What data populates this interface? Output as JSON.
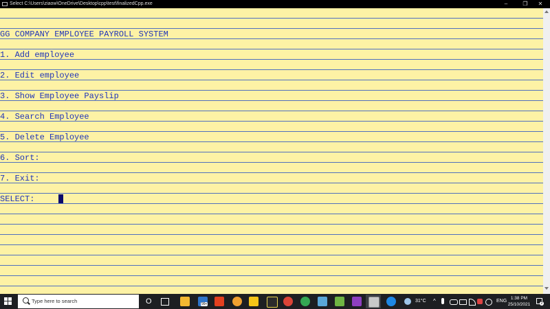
{
  "window": {
    "title": "Select C:\\Users\\ziaow\\OneDrive\\Desktop\\cpp\\test\\finalizedCpp.exe",
    "minimize_glyph": "–",
    "maximize_glyph": "❐",
    "close_glyph": "✕"
  },
  "console": {
    "heading": "GG COMPANY EMPLOYEE PAYROLL SYSTEM",
    "menu": [
      "1. Add employee",
      "2. Edit employee",
      "3. Show Employee Payslip",
      "4. Search Employee",
      "5. Delete Employee",
      "6. Sort:",
      "7. Exit:"
    ],
    "prompt": "SELECT:",
    "colors": {
      "background": "#fdf2a5",
      "text": "#1f35b8",
      "rule": "#4f6fbf"
    }
  },
  "taskbar": {
    "search_placeholder": "Type here to search",
    "mail_badge": "99+",
    "weather": "31°C",
    "language": "ENG",
    "time": "1:38 PM",
    "date": "25/10/2021",
    "notification_count": "2",
    "task_view_glyph": "O"
  }
}
